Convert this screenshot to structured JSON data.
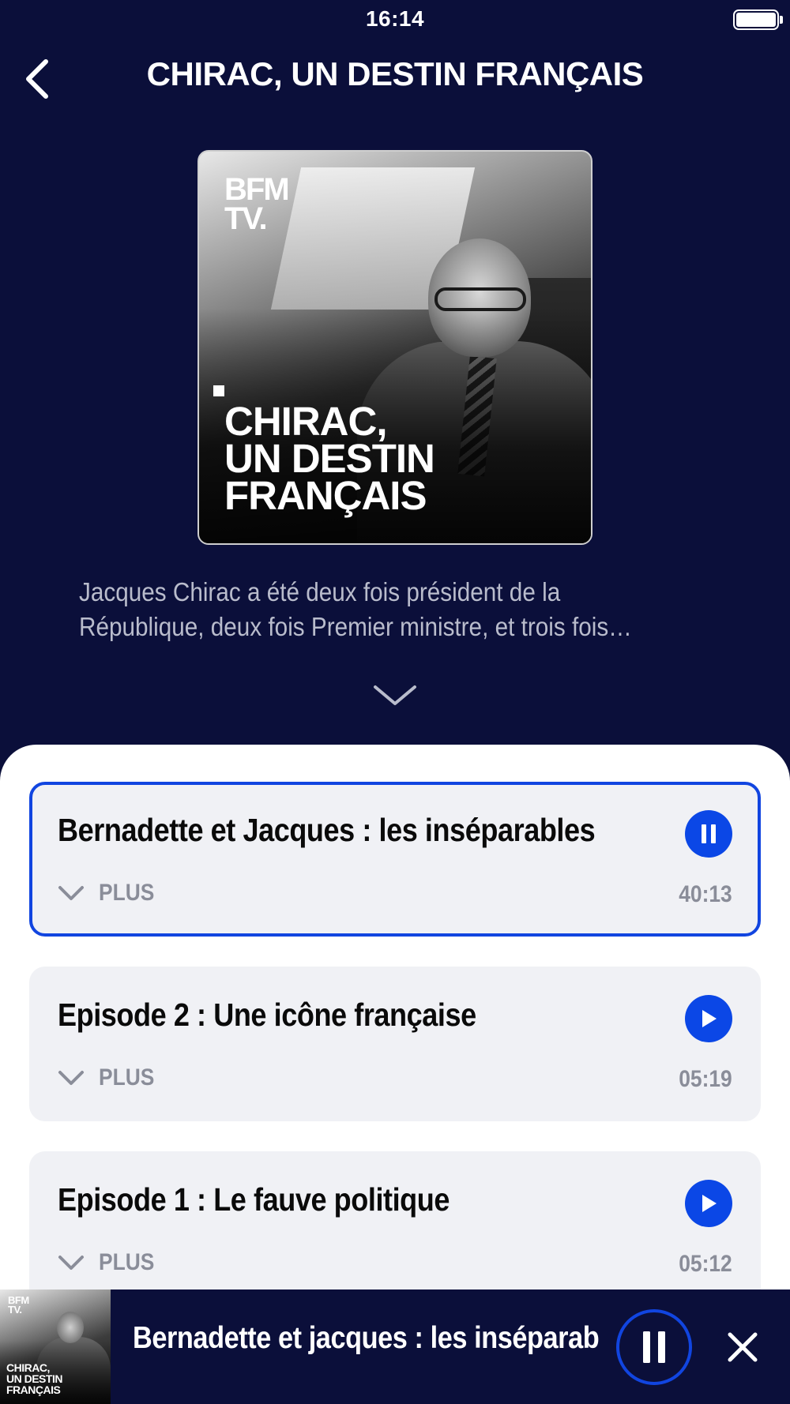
{
  "status_bar": {
    "time": "16:14"
  },
  "header": {
    "title": "CHIRAC, UN DESTIN FRANÇAIS"
  },
  "cover": {
    "logo_line1": "BFM",
    "logo_line2": "TV.",
    "title_lines": [
      "CHIRAC,",
      "UN DESTIN",
      "FRANÇAIS"
    ]
  },
  "description": {
    "line1": "Jacques Chirac a été deux fois président de la",
    "line2": "République, deux fois Premier ministre, et trois fois…"
  },
  "episodes": [
    {
      "title": "Bernadette et Jacques : les inséparables",
      "more_label": "PLUS",
      "duration": "40:13",
      "state": "playing"
    },
    {
      "title": "Episode 2 : Une icône française",
      "more_label": "PLUS",
      "duration": "05:19",
      "state": "paused"
    },
    {
      "title": "Episode 1 : Le fauve politique",
      "more_label": "PLUS",
      "duration": "05:12",
      "state": "paused"
    }
  ],
  "mini_player": {
    "title": "Bernadette et jacques : les inséparables",
    "thumb_logo_line1": "BFM",
    "thumb_logo_line2": "TV.",
    "thumb_title_lines": [
      "CHIRAC,",
      "UN DESTIN",
      "FRANÇAIS"
    ]
  },
  "colors": {
    "background": "#0b0f3a",
    "accent": "#0b47e6",
    "card": "#f0f1f5",
    "muted_text": "#8a8d99"
  },
  "icons": {
    "back": "chevron-left-icon",
    "expand": "chevron-down-icon",
    "play": "play-icon",
    "pause": "pause-icon",
    "close": "close-icon"
  }
}
